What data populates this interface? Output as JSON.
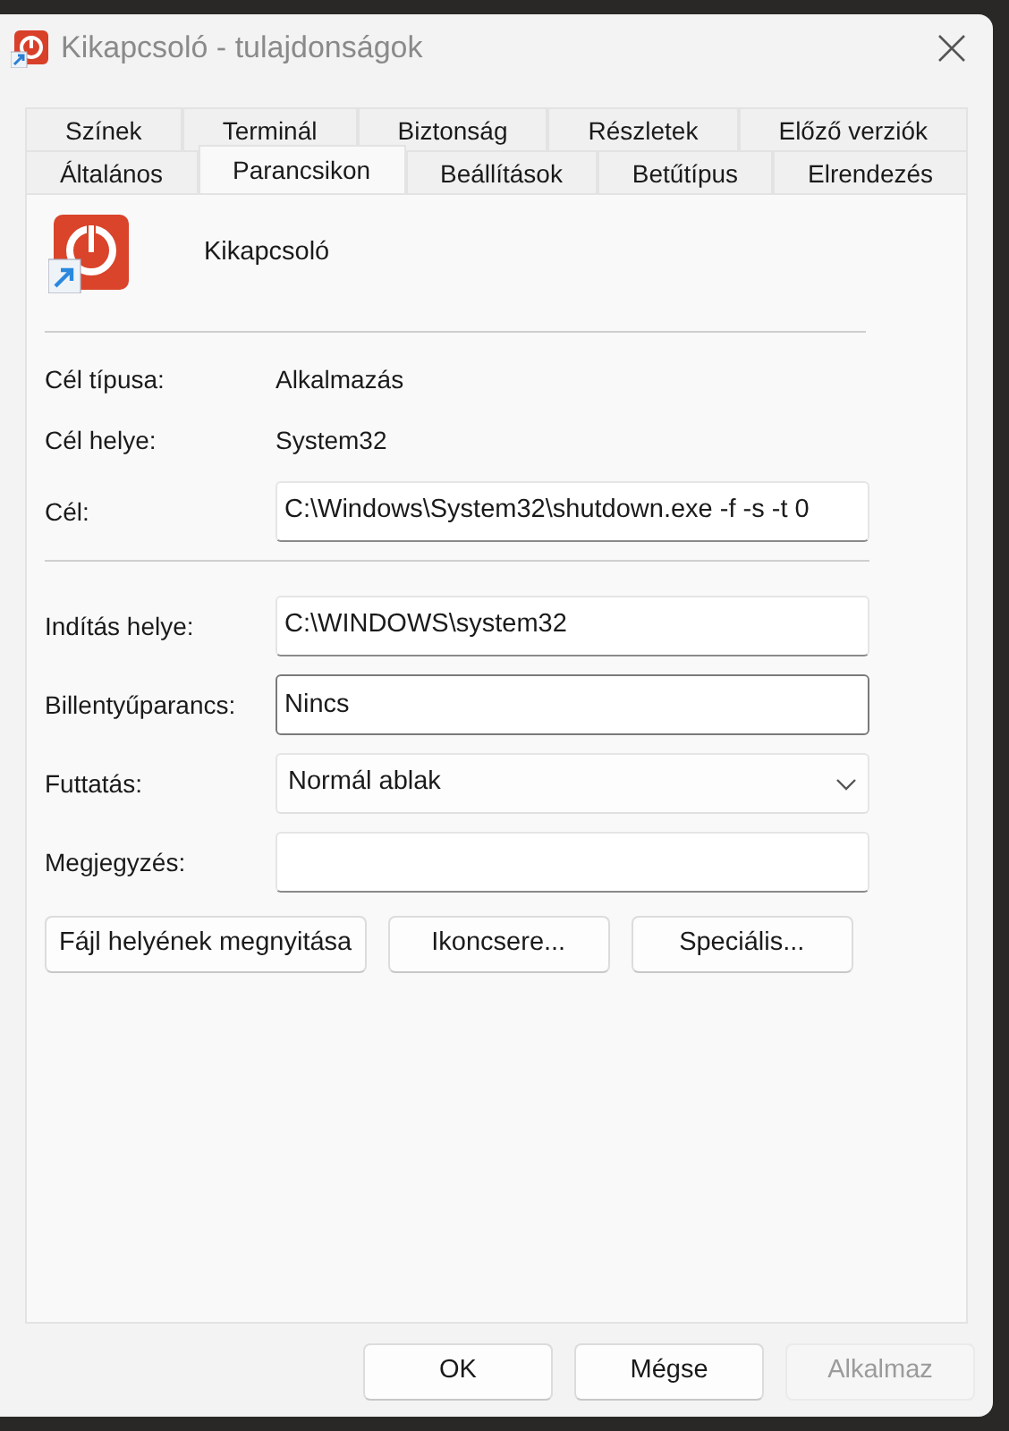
{
  "window": {
    "title": "Kikapcsoló - tulajdonságok"
  },
  "tab_rows": [
    [
      {
        "label": "Színek",
        "selected": false
      },
      {
        "label": "Terminál",
        "selected": false
      },
      {
        "label": "Biztonság",
        "selected": false
      },
      {
        "label": "Részletek",
        "selected": false
      },
      {
        "label": "Előző verziók",
        "selected": false
      }
    ],
    [
      {
        "label": "Általános",
        "selected": false
      },
      {
        "label": "Parancsikon",
        "selected": true
      },
      {
        "label": "Beállítások",
        "selected": false
      },
      {
        "label": "Betűtípus",
        "selected": false
      },
      {
        "label": "Elrendezés",
        "selected": false
      }
    ]
  ],
  "shortcut": {
    "name": "Kikapcsoló"
  },
  "info": [
    {
      "label": "Cél típusa:",
      "value": "Alkalmazás",
      "kind": "text"
    },
    {
      "label": "Cél helye:",
      "value": "System32",
      "kind": "text"
    },
    {
      "label": "Cél:",
      "value": "C:\\Windows\\System32\\shutdown.exe -f -s -t 0",
      "kind": "input"
    }
  ],
  "fields": [
    {
      "label": "Indítás helye:",
      "value": "C:\\WINDOWS\\system32",
      "kind": "input"
    },
    {
      "label": "Billentyűparancs:",
      "value": "Nincs",
      "kind": "hotkey"
    },
    {
      "label": "Futtatás:",
      "value": "Normál ablak",
      "kind": "select"
    },
    {
      "label": "Megjegyzés:",
      "kind": "input"
    }
  ],
  "actions": [
    "Fájl helyének megnyitása",
    "Ikoncsere...",
    "Speciális..."
  ],
  "buttons": [
    {
      "label": "OK",
      "disabled": false
    },
    {
      "label": "Mégse",
      "disabled": false
    },
    {
      "label": "Alkalmaz",
      "disabled": true
    }
  ]
}
